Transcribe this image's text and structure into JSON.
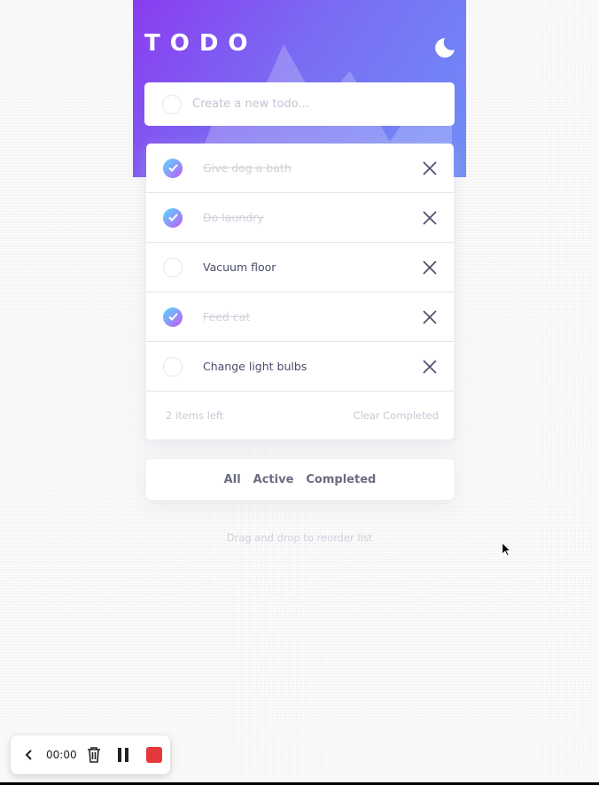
{
  "app": {
    "title": "TODO",
    "theme_icon": "moon-icon"
  },
  "new_todo": {
    "placeholder": "Create a new todo..."
  },
  "todos": [
    {
      "text": "Give dog a bath",
      "completed": true
    },
    {
      "text": "Do laundry",
      "completed": true
    },
    {
      "text": "Vacuum floor",
      "completed": false
    },
    {
      "text": "Feed cat",
      "completed": true
    },
    {
      "text": "Change light bulbs",
      "completed": false
    }
  ],
  "footer": {
    "items_left": "2 items left",
    "clear_label": "Clear Completed"
  },
  "filters": {
    "all": "All",
    "active": "Active",
    "completed": "Completed"
  },
  "hint": "Drag and drop to reorder list",
  "recorder": {
    "time": "00:00",
    "stop_color": "#e5383b"
  },
  "colors": {
    "check_gradient_start": "#55ddff",
    "check_gradient_end": "#c058f3",
    "header_gradient_start": "#8a3cf0",
    "header_gradient_end": "#6f8ef7"
  }
}
